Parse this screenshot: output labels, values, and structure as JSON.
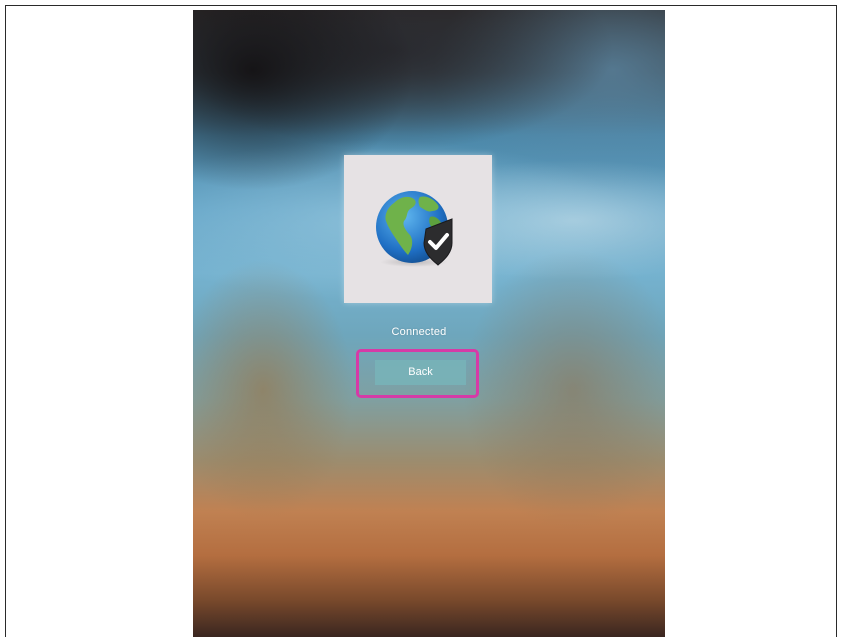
{
  "status": {
    "label": "Connected"
  },
  "actions": {
    "back_label": "Back"
  },
  "icon": {
    "name": "globe-shield-check-icon"
  },
  "colors": {
    "highlight": "#d63aa7",
    "button": "#78b4b9",
    "card": "#e6e2e4"
  }
}
